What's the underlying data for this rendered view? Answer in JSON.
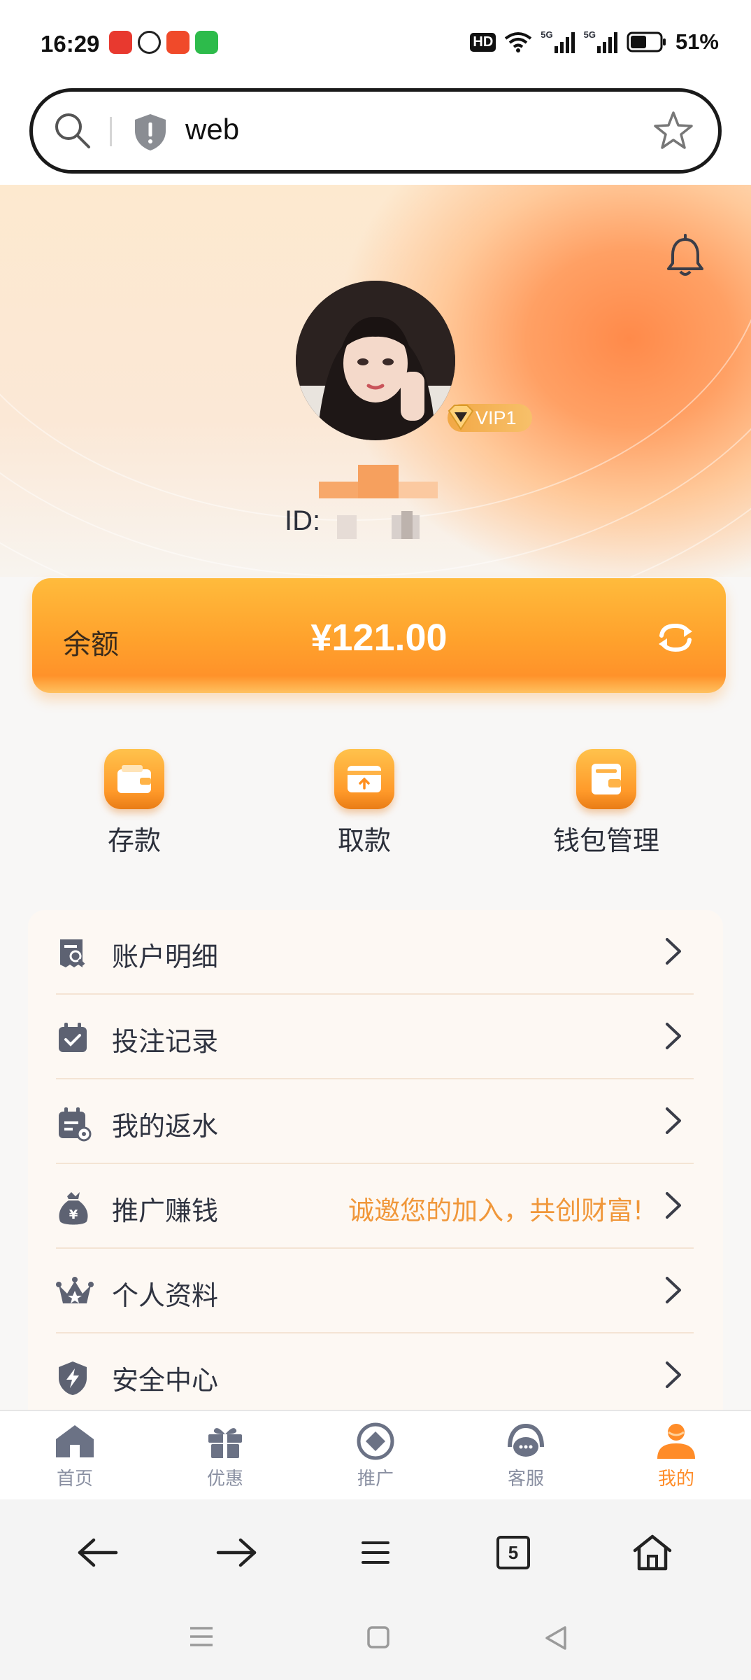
{
  "status_bar": {
    "time": "16:29",
    "network": "HD",
    "signal_label_1": "5G",
    "signal_label_2": "5G",
    "battery": "51%"
  },
  "url_bar": {
    "text": "web",
    "search_icon": "search-icon",
    "security_icon": "shield-icon",
    "bookmark_icon": "star-icon"
  },
  "profile": {
    "vip_level": "VIP1",
    "id_label": "ID:"
  },
  "balance": {
    "label": "余额",
    "amount": "¥121.00"
  },
  "quick_actions": [
    {
      "label": "存款",
      "icon": "wallet-icon"
    },
    {
      "label": "取款",
      "icon": "card-withdraw-icon"
    },
    {
      "label": "钱包管理",
      "icon": "wallet-manage-icon"
    }
  ],
  "menu": [
    {
      "label": "账户明细",
      "icon": "receipt-search-icon",
      "extra": ""
    },
    {
      "label": "投注记录",
      "icon": "calendar-check-icon",
      "extra": ""
    },
    {
      "label": "我的返水",
      "icon": "calendar-rebate-icon",
      "extra": ""
    },
    {
      "label": "推广赚钱",
      "icon": "money-bag-icon",
      "extra": "诚邀您的加入，共创财富!"
    },
    {
      "label": "个人资料",
      "icon": "crown-icon",
      "extra": ""
    },
    {
      "label": "安全中心",
      "icon": "shield-bolt-icon",
      "extra": ""
    }
  ],
  "tabs": [
    {
      "label": "首页",
      "icon": "home-icon",
      "active": false
    },
    {
      "label": "优惠",
      "icon": "gift-icon",
      "active": false
    },
    {
      "label": "推广",
      "icon": "promote-icon",
      "active": false
    },
    {
      "label": "客服",
      "icon": "headset-icon",
      "active": false
    },
    {
      "label": "我的",
      "icon": "user-icon",
      "active": true
    }
  ],
  "browser": {
    "tab_count": "5"
  },
  "colors": {
    "accent": "#ff9a2a",
    "menu_extra": "#f0973a",
    "tab_active": "#ff8c28",
    "tab_inactive": "#8a90a2"
  }
}
